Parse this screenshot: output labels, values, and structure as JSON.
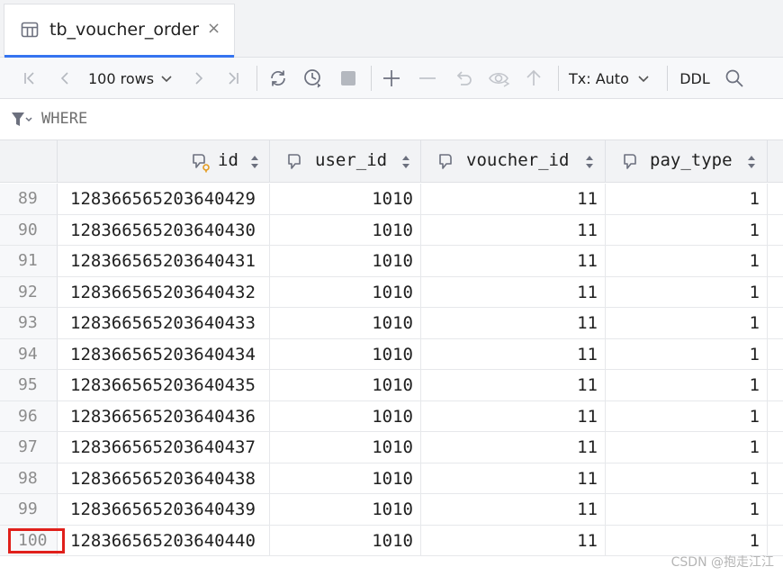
{
  "tab": {
    "title": "tb_voucher_order",
    "close": "×",
    "icon": "table-grid-icon"
  },
  "toolbar": {
    "rows_label": "100 rows",
    "tx_label": "Tx: Auto",
    "ddl_label": "DDL",
    "icons": [
      "first-page-icon",
      "prev-page-icon",
      "chevron-down-icon",
      "next-page-icon",
      "last-page-icon",
      "refresh-icon",
      "history-icon",
      "stop-icon",
      "add-row-icon",
      "delete-row-icon",
      "revert-icon",
      "preview-icon",
      "submit-icon",
      "search-icon"
    ]
  },
  "filter": {
    "placeholder": "WHERE",
    "icon": "filter-icon"
  },
  "table": {
    "columns": [
      {
        "label": "id",
        "icon": "primary-key-column-icon"
      },
      {
        "label": "user_id",
        "icon": "column-icon"
      },
      {
        "label": "voucher_id",
        "icon": "column-icon"
      },
      {
        "label": "pay_type",
        "icon": "column-icon"
      }
    ],
    "rows": [
      {
        "num": "89",
        "cells": [
          "128366565203640429",
          "1010",
          "11",
          "1"
        ]
      },
      {
        "num": "90",
        "cells": [
          "128366565203640430",
          "1010",
          "11",
          "1"
        ]
      },
      {
        "num": "91",
        "cells": [
          "128366565203640431",
          "1010",
          "11",
          "1"
        ]
      },
      {
        "num": "92",
        "cells": [
          "128366565203640432",
          "1010",
          "11",
          "1"
        ]
      },
      {
        "num": "93",
        "cells": [
          "128366565203640433",
          "1010",
          "11",
          "1"
        ]
      },
      {
        "num": "94",
        "cells": [
          "128366565203640434",
          "1010",
          "11",
          "1"
        ]
      },
      {
        "num": "95",
        "cells": [
          "128366565203640435",
          "1010",
          "11",
          "1"
        ]
      },
      {
        "num": "96",
        "cells": [
          "128366565203640436",
          "1010",
          "11",
          "1"
        ]
      },
      {
        "num": "97",
        "cells": [
          "128366565203640437",
          "1010",
          "11",
          "1"
        ]
      },
      {
        "num": "98",
        "cells": [
          "128366565203640438",
          "1010",
          "11",
          "1"
        ]
      },
      {
        "num": "99",
        "cells": [
          "128366565203640439",
          "1010",
          "11",
          "1"
        ]
      },
      {
        "num": "100",
        "cells": [
          "128366565203640440",
          "1010",
          "11",
          "1"
        ]
      }
    ],
    "highlighted_row": "100"
  },
  "watermark": "CSDN @抱走江江",
  "colors": {
    "accent": "#3574f0",
    "highlight": "#e0201b",
    "header_bg": "#f2f3f5"
  }
}
